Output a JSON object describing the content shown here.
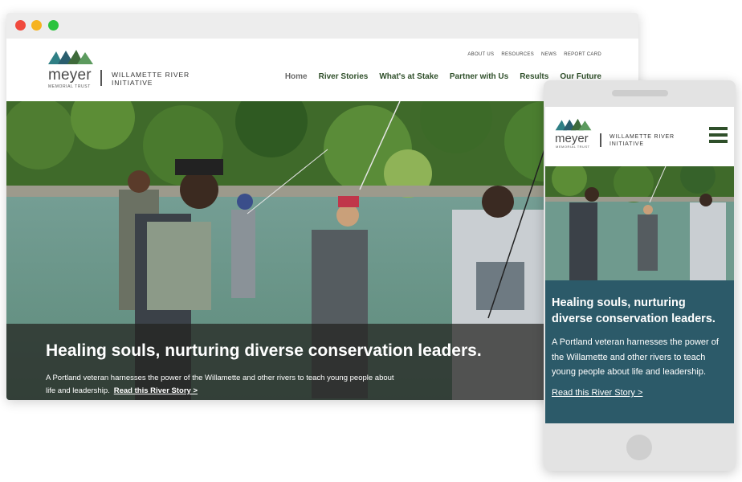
{
  "brand": {
    "name": "meyer",
    "trust": "MEMORIAL TRUST",
    "initiative": "WILLAMETTE RIVER INITIATIVE",
    "colors": {
      "green": "#2f4f2a",
      "teal": "#2c5a69"
    }
  },
  "desktop": {
    "util_nav": [
      "ABOUT US",
      "RESOURCES",
      "NEWS",
      "REPORT CARD"
    ],
    "main_nav": [
      "Home",
      "River Stories",
      "What's at Stake",
      "Partner with Us",
      "Results",
      "Our Future"
    ],
    "hero": {
      "headline": "Healing souls, nurturing diverse conservation leaders.",
      "body": "A Portland veteran harnesses the power of the Willamette and other rivers to teach young people about life and leadership.",
      "link": "Read this River Story >"
    }
  },
  "mobile": {
    "menu_icon": "hamburger-icon",
    "headline": "Healing souls, nurturing diverse conservation leaders.",
    "body": "A Portland veteran harnesses the power of the Willamette and other rivers to teach young people about life and leadership.",
    "link": "Read this River Story >"
  }
}
